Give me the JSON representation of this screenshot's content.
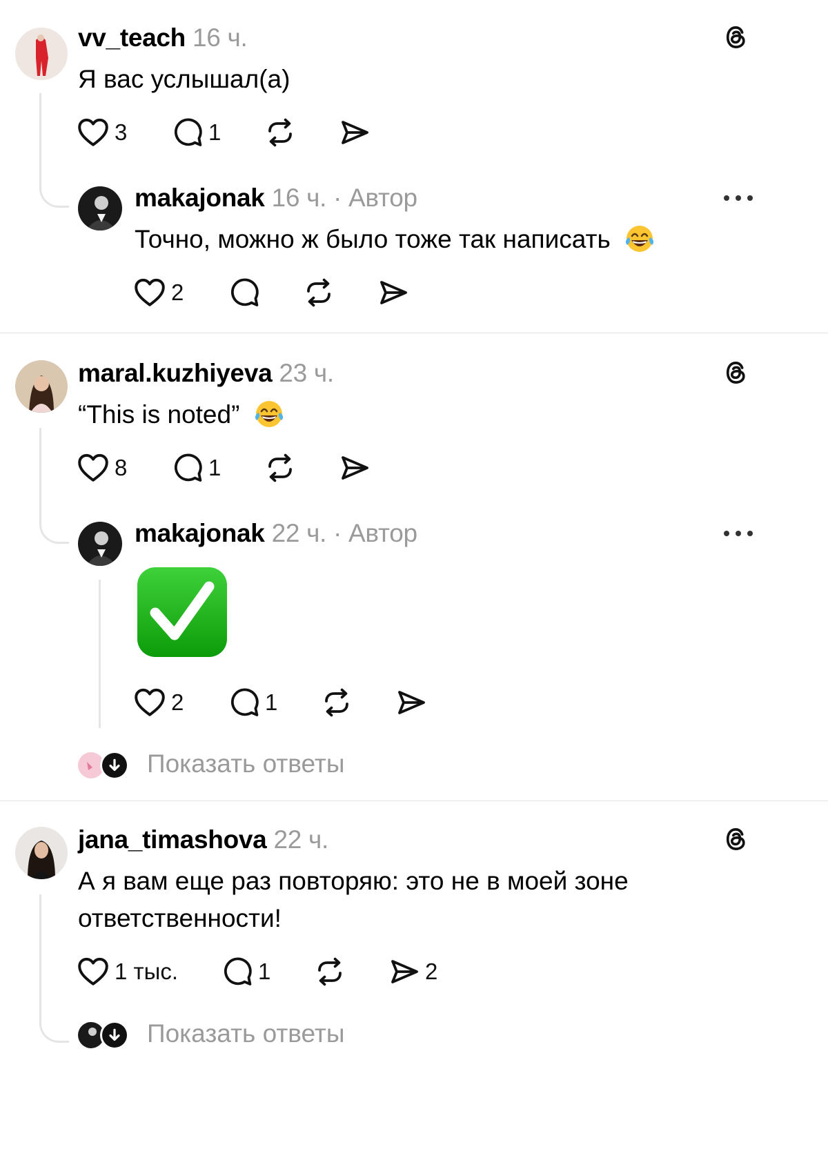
{
  "comments": [
    {
      "username": "vv_teach",
      "time": "16 ч.",
      "text": "Я вас услышал(а)",
      "likes": "3",
      "replies": "1",
      "shares": "",
      "reply": {
        "username": "makajonak",
        "time": "16 ч. · Автор",
        "text": "Точно, можно ж было тоже так написать",
        "likes": "2",
        "replies": "",
        "shares": ""
      }
    },
    {
      "username": "maral.kuzhiyeva",
      "time": "23 ч.",
      "text": "“This is noted”",
      "likes": "8",
      "replies": "1",
      "shares": "",
      "reply": {
        "username": "makajonak",
        "time": "22 ч. · Автор",
        "text": "",
        "likes": "2",
        "replies": "1",
        "shares": ""
      },
      "show_replies": "Показать ответы"
    },
    {
      "username": "jana_timashova",
      "time": "22 ч.",
      "text_line1": "А я вам еще раз повторяю: это не в моей зоне",
      "text_line2": "ответственности!",
      "likes": "1 тыс.",
      "replies": "1",
      "shares": "2",
      "show_replies": "Показать ответы"
    }
  ],
  "icons": [
    "threads-logo-icon",
    "heart-icon",
    "comment-icon",
    "repost-icon",
    "share-icon",
    "more-icon",
    "arrow-down-icon",
    "laughing-emoji",
    "check-mark-emoji"
  ],
  "colors": {
    "text": "#000000",
    "muted": "#9a9a9a",
    "check_green": "#16b014"
  }
}
